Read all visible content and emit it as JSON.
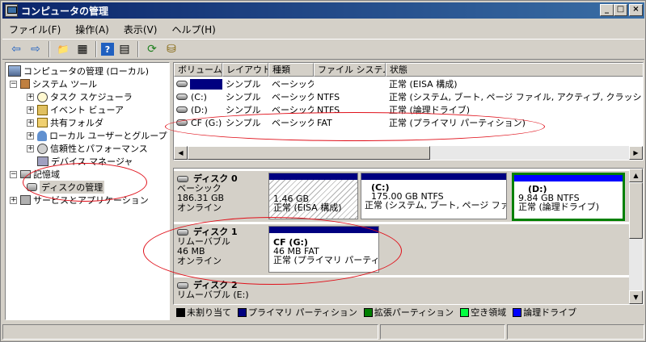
{
  "window": {
    "title": "コンピュータの管理"
  },
  "menu": [
    "ファイル(F)",
    "操作(A)",
    "表示(V)",
    "ヘルプ(H)"
  ],
  "toolbar": {
    "icons": [
      "back-arrow-icon",
      "forward-arrow-icon",
      "folder-up-icon",
      "show-hide-tree-icon",
      "help-icon",
      "properties-icon",
      "refresh-icon",
      "export-icon"
    ],
    "glyphs": [
      "⇦",
      "⇨",
      "📁",
      "▦",
      "?",
      "▤",
      "⟳",
      "⛁"
    ]
  },
  "tree": {
    "root": "コンピュータの管理 (ローカル)",
    "system_tools": "システム ツール",
    "task_scheduler": "タスク スケジューラ",
    "event_viewer": "イベント ビューア",
    "shared_folders": "共有フォルダ",
    "local_users": "ローカル ユーザーとグループ",
    "reliability": "信頼性とパフォーマンス",
    "device_manager": "デバイス マネージャ",
    "storage": "記憶域",
    "disk_management": "ディスクの管理",
    "services_apps": "サービスとアプリケーション"
  },
  "volume_list": {
    "headers": [
      "ボリューム",
      "レイアウト",
      "種類",
      "ファイル システム",
      "状態"
    ],
    "rows": [
      {
        "volume": "",
        "layout": "シンプル",
        "type": "ベーシック",
        "fs": "",
        "status": "正常 (EISA 構成)"
      },
      {
        "volume": "(C:)",
        "layout": "シンプル",
        "type": "ベーシック",
        "fs": "NTFS",
        "status": "正常 (システム, ブート, ページ ファイル, アクティブ, クラッシュ ダンプ, プ"
      },
      {
        "volume": "(D:)",
        "layout": "シンプル",
        "type": "ベーシック",
        "fs": "NTFS",
        "status": "正常 (論理ドライブ)"
      },
      {
        "volume": "CF (G:)",
        "layout": "シンプル",
        "type": "ベーシック",
        "fs": "FAT",
        "status": "正常 (プライマリ パーティション)"
      }
    ]
  },
  "disks": {
    "disk0": {
      "name": "ディスク 0",
      "kind": "ベーシック",
      "size": "186.31 GB",
      "state": "オンライン",
      "partitions": [
        {
          "name": "",
          "size": "1.46 GB",
          "status": "正常 (EISA 構成)"
        },
        {
          "name": "(C:)",
          "size": "175.00 GB NTFS",
          "status": "正常 (システム, ブート, ページ ファイ/"
        },
        {
          "name": "(D:)",
          "size": "9.84 GB NTFS",
          "status": "正常 (論理ドライブ)"
        }
      ]
    },
    "disk1": {
      "name": "ディスク 1",
      "kind": "リムーバブル",
      "size": "46 MB",
      "state": "オンライン",
      "partitions": [
        {
          "name": "CF  (G:)",
          "size": "46 MB FAT",
          "status": "正常 (プライマリ パーティシ"
        }
      ]
    },
    "disk2": {
      "name": "ディスク 2",
      "kind": "リムーバブル (E:)"
    }
  },
  "legend": [
    {
      "label": "未割り当て",
      "color": "#000000"
    },
    {
      "label": "プライマリ パーティション",
      "color": "#000080"
    },
    {
      "label": "拡張パーティション",
      "color": "#008000"
    },
    {
      "label": "空き領域",
      "color": "#00ff40"
    },
    {
      "label": "論理ドライブ",
      "color": "#0000ff"
    }
  ],
  "colors": {
    "primary_bar": "#000080",
    "logical_bar": "#0000ff",
    "extended_border": "#008000",
    "annotation": "#e0101a",
    "titlebar": "#0a246a"
  }
}
